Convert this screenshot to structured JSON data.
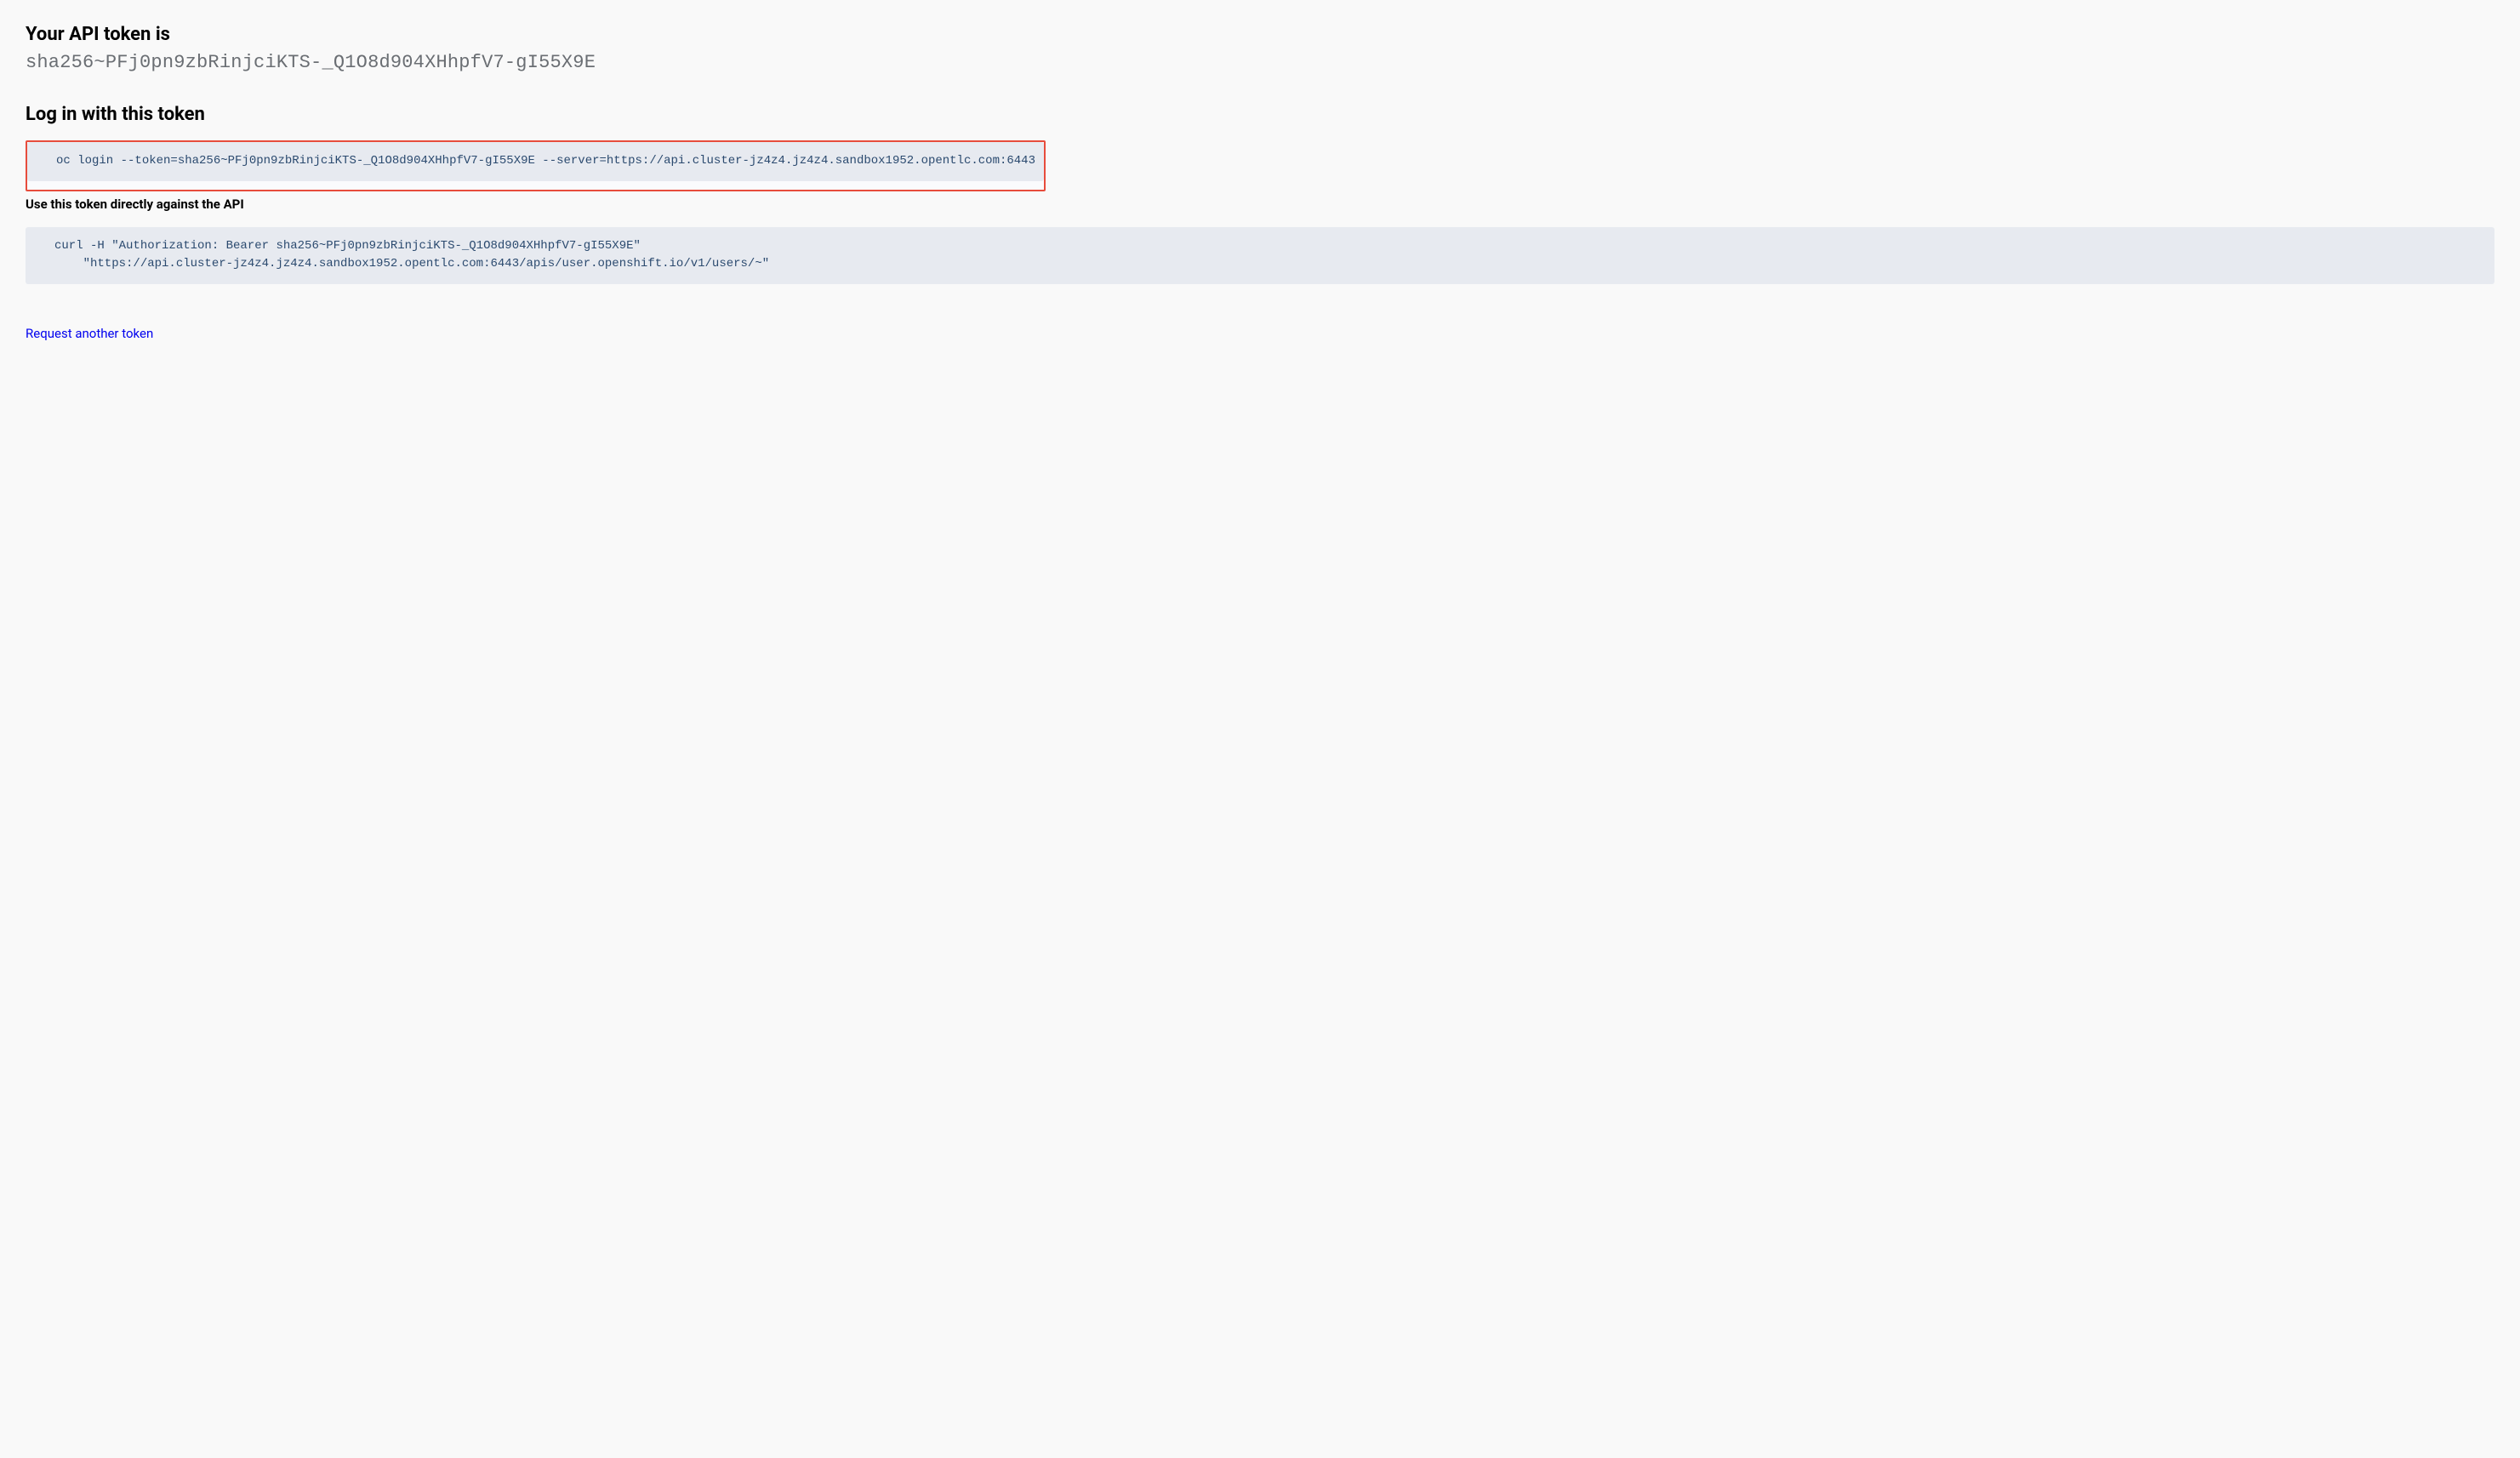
{
  "headings": {
    "api_token": "Your API token is",
    "login": "Log in with this token",
    "use_directly": "Use this token directly against the API"
  },
  "token": "sha256~PFj0pn9zbRinjciKTS-_Q1O8d904XHhpfV7-gI55X9E",
  "oc_login_command": "oc login --token=sha256~PFj0pn9zbRinjciKTS-_Q1O8d904XHhpfV7-gI55X9E --server=https://api.cluster-jz4z4.jz4z4.sandbox1952.opentlc.com:6443",
  "curl_command": "curl -H \"Authorization: Bearer sha256~PFj0pn9zbRinjciKTS-_Q1O8d904XHhpfV7-gI55X9E\"\n    \"https://api.cluster-jz4z4.jz4z4.sandbox1952.opentlc.com:6443/apis/user.openshift.io/v1/users/~\"",
  "request_another": "Request another token"
}
